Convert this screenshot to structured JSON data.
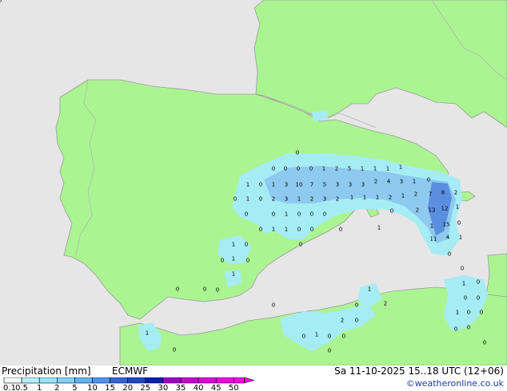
{
  "map": {
    "colors": {
      "sea": "#e6e6e6",
      "land": "#aaf591",
      "border": "#b4b4b4",
      "coast": "#9a9a9a",
      "precip_light": "#a6ecf5",
      "precip_mid": "#8ec9ef",
      "precip_heavy": "#5a8fe0"
    },
    "values": [
      {
        "v": "0"
      },
      {
        "v": "0"
      },
      {
        "v": "0"
      },
      {
        "v": "0"
      },
      {
        "v": "1"
      },
      {
        "v": "2"
      },
      {
        "v": "5"
      },
      {
        "v": "1"
      },
      {
        "v": "1"
      },
      {
        "v": "1"
      },
      {
        "v": "1"
      },
      {
        "v": "0"
      },
      {
        "v": "1"
      },
      {
        "v": "0"
      },
      {
        "v": "1"
      },
      {
        "v": "3"
      },
      {
        "v": "10"
      },
      {
        "v": "7"
      },
      {
        "v": "5"
      },
      {
        "v": "3"
      },
      {
        "v": "3"
      },
      {
        "v": "3"
      },
      {
        "v": "2"
      },
      {
        "v": "4"
      },
      {
        "v": "3"
      },
      {
        "v": "1"
      },
      {
        "v": "0"
      },
      {
        "v": "0"
      },
      {
        "v": "1"
      },
      {
        "v": "0"
      },
      {
        "v": "2"
      },
      {
        "v": "3"
      },
      {
        "v": "1"
      },
      {
        "v": "2"
      },
      {
        "v": "3"
      },
      {
        "v": "2"
      },
      {
        "v": "1"
      },
      {
        "v": "1"
      },
      {
        "v": "1"
      },
      {
        "v": "2"
      },
      {
        "v": "1"
      },
      {
        "v": "2"
      },
      {
        "v": "7"
      },
      {
        "v": "8"
      },
      {
        "v": "2"
      },
      {
        "v": "0"
      },
      {
        "v": "0"
      },
      {
        "v": "1"
      },
      {
        "v": "0"
      },
      {
        "v": "0"
      },
      {
        "v": "0"
      },
      {
        "v": "0"
      },
      {
        "v": "2"
      },
      {
        "v": "13"
      },
      {
        "v": "12"
      },
      {
        "v": "1"
      },
      {
        "v": "0"
      },
      {
        "v": "1"
      },
      {
        "v": "1"
      },
      {
        "v": "0"
      },
      {
        "v": "0"
      },
      {
        "v": "0"
      },
      {
        "v": "1"
      },
      {
        "v": "1"
      },
      {
        "v": "15"
      },
      {
        "v": "0"
      },
      {
        "v": "1"
      },
      {
        "v": "0"
      },
      {
        "v": "0"
      },
      {
        "v": "11"
      },
      {
        "v": "4"
      },
      {
        "v": "1"
      },
      {
        "v": "1"
      },
      {
        "v": "0"
      },
      {
        "v": "0"
      },
      {
        "v": "0"
      },
      {
        "v": "0"
      },
      {
        "v": "1"
      },
      {
        "v": "0"
      },
      {
        "v": "0"
      },
      {
        "v": "0"
      },
      {
        "v": "0"
      },
      {
        "v": "0"
      },
      {
        "v": "1"
      },
      {
        "v": "2"
      },
      {
        "v": "1"
      },
      {
        "v": "0"
      },
      {
        "v": "0"
      },
      {
        "v": "0"
      },
      {
        "v": "1"
      },
      {
        "v": "0"
      },
      {
        "v": "0"
      },
      {
        "v": "0"
      },
      {
        "v": "0"
      },
      {
        "v": "0"
      },
      {
        "v": "1"
      },
      {
        "v": "0"
      },
      {
        "v": "2"
      },
      {
        "v": "0"
      },
      {
        "v": "0"
      },
      {
        "v": "1"
      },
      {
        "v": "0"
      },
      {
        "v": "0"
      },
      {
        "v": "0"
      },
      {
        "v": "0"
      }
    ]
  },
  "footer": {
    "title": "Precipitation [mm]",
    "model": "ECMWF",
    "datetime": "Sa 11-10-2025 15..18 UTC (12+06)",
    "credit": "©weatheronline.co.uk",
    "legend": {
      "labels": [
        "0.1",
        "0.5",
        "1",
        "2",
        "5",
        "10",
        "15",
        "20",
        "25",
        "30",
        "35",
        "40",
        "45",
        "50"
      ],
      "colors": [
        "#f5fafa",
        "#b4f0fa",
        "#96e6fa",
        "#82d2fa",
        "#64b4f5",
        "#4b96f0",
        "#3264dc",
        "#1e46c8",
        "#0a1eb4",
        "#a000c8",
        "#c800d2",
        "#e100dc",
        "#f000e6",
        "#ff00f0"
      ]
    }
  }
}
